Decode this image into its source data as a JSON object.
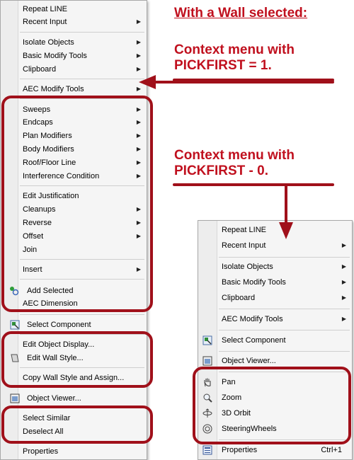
{
  "annotations": {
    "heading": "With a Wall selected:",
    "pick1_line1": "Context menu with",
    "pick1_line2": "PICKFIRST = 1.",
    "pick0_line1": "Context menu with",
    "pick0_line2": "PICKFIRST - 0."
  },
  "colors": {
    "annotation": "#c0101e",
    "ring": "#a0101a",
    "menu_bg": "#f5f5f5"
  },
  "left_menu": {
    "items": [
      {
        "label": "Repeat LINE"
      },
      {
        "label": "Recent Input",
        "submenu": true
      },
      {
        "label": "Isolate Objects",
        "submenu": true
      },
      {
        "label": "Basic Modify Tools",
        "submenu": true
      },
      {
        "label": "Clipboard",
        "submenu": true
      },
      {
        "label": "AEC Modify Tools",
        "submenu": true
      },
      {
        "label": "Sweeps",
        "submenu": true
      },
      {
        "label": "Endcaps",
        "submenu": true
      },
      {
        "label": "Plan Modifiers",
        "submenu": true
      },
      {
        "label": "Body Modifiers",
        "submenu": true
      },
      {
        "label": "Roof/Floor Line",
        "submenu": true
      },
      {
        "label": "Interference Condition",
        "submenu": true
      },
      {
        "label": "Edit Justification"
      },
      {
        "label": "Cleanups",
        "submenu": true
      },
      {
        "label": "Reverse",
        "submenu": true
      },
      {
        "label": "Offset",
        "submenu": true
      },
      {
        "label": "Join"
      },
      {
        "label": "Insert",
        "submenu": true
      },
      {
        "label": "Add Selected",
        "icon": "add-selected-icon"
      },
      {
        "label": "AEC Dimension"
      },
      {
        "label": "Select Component",
        "icon": "select-component-icon"
      },
      {
        "label": "Edit Object Display..."
      },
      {
        "label": "Edit Wall Style...",
        "icon": "wall-style-icon"
      },
      {
        "label": "Copy Wall Style and Assign..."
      },
      {
        "label": "Object Viewer...",
        "icon": "object-viewer-icon"
      },
      {
        "label": "Select Similar"
      },
      {
        "label": "Deselect All"
      },
      {
        "label": "Properties"
      }
    ]
  },
  "right_menu": {
    "items": [
      {
        "label": "Repeat LINE"
      },
      {
        "label": "Recent Input",
        "submenu": true
      },
      {
        "label": "Isolate Objects",
        "submenu": true
      },
      {
        "label": "Basic Modify Tools",
        "submenu": true
      },
      {
        "label": "Clipboard",
        "submenu": true
      },
      {
        "label": "AEC Modify Tools",
        "submenu": true
      },
      {
        "label": "Select Component",
        "icon": "select-component-icon"
      },
      {
        "label": "Object Viewer...",
        "icon": "object-viewer-icon"
      },
      {
        "label": "Pan",
        "icon": "pan-hand-icon"
      },
      {
        "label": "Zoom",
        "icon": "zoom-icon"
      },
      {
        "label": "3D Orbit",
        "icon": "orbit-icon"
      },
      {
        "label": "SteeringWheels",
        "icon": "steering-wheel-icon"
      },
      {
        "label": "Properties",
        "icon": "properties-icon",
        "shortcut": "Ctrl+1"
      }
    ]
  }
}
